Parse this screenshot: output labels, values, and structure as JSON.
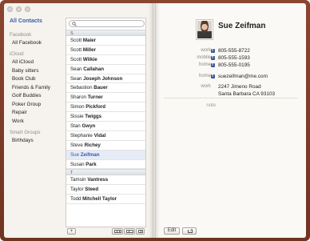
{
  "window": {
    "lights": [
      "close",
      "minimize",
      "zoom"
    ]
  },
  "groups": {
    "all_contacts": "All Contacts",
    "sections": [
      {
        "header": "Facebook",
        "items": [
          "All Facebook"
        ]
      },
      {
        "header": "iCloud",
        "items": [
          "All iCloud",
          "Baby sitters",
          "Book Club",
          "Friends & Family",
          "Golf Buddies",
          "Poker Group",
          "Repair",
          "Work"
        ]
      },
      {
        "header": "Smart Groups",
        "items": [
          "Birthdays"
        ]
      }
    ]
  },
  "search": {
    "placeholder": "",
    "value": ""
  },
  "list": {
    "section_s": "S",
    "section_t": "T",
    "s_rows": [
      {
        "first": "Scott",
        "last": "Maier"
      },
      {
        "first": "Scott",
        "last": "Miller"
      },
      {
        "first": "Scott",
        "last": "Wilkie"
      },
      {
        "first": "Sean",
        "last": "Callahan"
      },
      {
        "first": "Sean",
        "last": "Joseph Johnson"
      },
      {
        "first": "Sebastion",
        "last": "Bauer"
      },
      {
        "first": "Sharon",
        "last": "Turner"
      },
      {
        "first": "Simon",
        "last": "Pickford"
      },
      {
        "first": "Sissie",
        "last": "Twiggs"
      },
      {
        "first": "Stan",
        "last": "Gwyn"
      },
      {
        "first": "Stephanie",
        "last": "Vidal"
      },
      {
        "first": "Steve",
        "last": "Richey"
      },
      {
        "first": "Sue",
        "last": "Zeifman",
        "selected": true
      },
      {
        "first": "Susan",
        "last": "Park"
      }
    ],
    "t_rows": [
      {
        "first": "Tamsin",
        "last": "Vantress"
      },
      {
        "first": "Taylor",
        "last": "Steed"
      },
      {
        "first": "Todd",
        "last": "Mitchell Taylor"
      }
    ]
  },
  "left_toolbar": {
    "add_label": "+"
  },
  "card": {
    "name": "Sue Zeifman",
    "phones": [
      {
        "label": "work",
        "value": "805-555-8722"
      },
      {
        "label": "mobile",
        "value": "805-555-1593"
      },
      {
        "label": "home",
        "value": "805-555-0195"
      }
    ],
    "email": {
      "label": "home",
      "value": "suezeifman@me.com"
    },
    "address": {
      "label": "work",
      "line1": "2247 Jimeno Road",
      "line2": "Santa Barbara CA 93103"
    },
    "note_label": "note"
  },
  "right_toolbar": {
    "edit_label": "Edit"
  }
}
